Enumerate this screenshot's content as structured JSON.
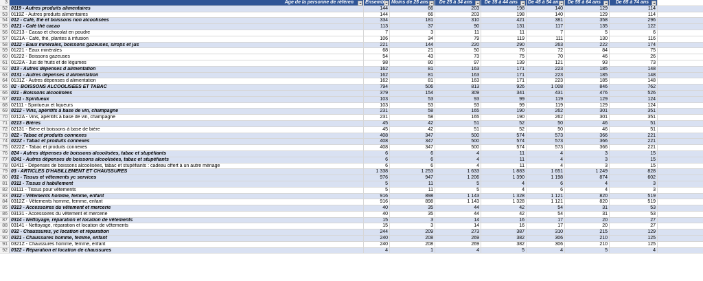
{
  "header": {
    "row_num": "3",
    "title": "Âge de la personne de référen",
    "columns": [
      "Ensemble",
      "Moins de 25 ans",
      "De 25 à 34 ans",
      "De 35 à 44 ans",
      "De 45 à 54 ans",
      "De 55 à 64 ans",
      "De 65 à 74 ans"
    ]
  },
  "rows": [
    {
      "n": "52",
      "label": "0119 - Autres produits alimentaires",
      "bold": true,
      "vals": [
        "144",
        "66",
        "203",
        "198",
        "140",
        "129",
        "114"
      ]
    },
    {
      "n": "53",
      "label": "0119Z - Autres produits alimentaires",
      "bold": false,
      "vals": [
        "144",
        "66",
        "203",
        "198",
        "140",
        "129",
        "114"
      ]
    },
    {
      "n": "54",
      "label": "012 - Café, thé et boissons non alcoolisées",
      "bold": true,
      "vals": [
        "334",
        "181",
        "310",
        "421",
        "381",
        "358",
        "296"
      ]
    },
    {
      "n": "55",
      "label": "0121 - Café thé cacao",
      "bold": true,
      "vals": [
        "113",
        "37",
        "90",
        "131",
        "117",
        "135",
        "122"
      ]
    },
    {
      "n": "56",
      "label": "01213 - Cacao et chocolat en poudre",
      "bold": false,
      "vals": [
        "7",
        "3",
        "11",
        "11",
        "7",
        "5",
        "6"
      ]
    },
    {
      "n": "57",
      "label": "0121A - Café, thé, plantes à infusion",
      "bold": false,
      "vals": [
        "106",
        "34",
        "79",
        "119",
        "111",
        "130",
        "116"
      ]
    },
    {
      "n": "58",
      "label": "0122 - Eaux minérales, boissons gazeuses, sirops et jus",
      "bold": true,
      "vals": [
        "221",
        "144",
        "220",
        "290",
        "263",
        "222",
        "174"
      ]
    },
    {
      "n": "59",
      "label": "01221 - Eaux minérales",
      "bold": false,
      "vals": [
        "68",
        "21",
        "50",
        "76",
        "72",
        "84",
        "75"
      ]
    },
    {
      "n": "60",
      "label": "01222 - Boissons gazeuses",
      "bold": false,
      "vals": [
        "54",
        "43",
        "73",
        "75",
        "70",
        "46",
        "26"
      ]
    },
    {
      "n": "61",
      "label": "0122A - Jus de fruits et de légumes",
      "bold": false,
      "vals": [
        "98",
        "80",
        "97",
        "139",
        "121",
        "93",
        "73"
      ]
    },
    {
      "n": "62",
      "label": "013 - Autres dépenses d alimentation",
      "bold": true,
      "vals": [
        "162",
        "81",
        "163",
        "171",
        "223",
        "185",
        "148"
      ]
    },
    {
      "n": "63",
      "label": "0131 - Autres dépenses d alimentation",
      "bold": true,
      "vals": [
        "162",
        "81",
        "163",
        "171",
        "223",
        "185",
        "148"
      ]
    },
    {
      "n": "64",
      "label": "0131Z - Autres dépenses d alimentation",
      "bold": false,
      "vals": [
        "162",
        "81",
        "163",
        "171",
        "223",
        "185",
        "148"
      ]
    },
    {
      "n": "65",
      "label": "02 - BOISSONS ALCOOLISEES ET TABAC",
      "bold": true,
      "vals": [
        "794",
        "506",
        "813",
        "926",
        "1 008",
        "846",
        "762"
      ]
    },
    {
      "n": "66",
      "label": "021 - Boissons alcoolisées",
      "bold": true,
      "vals": [
        "379",
        "154",
        "309",
        "341",
        "431",
        "476",
        "526"
      ]
    },
    {
      "n": "67",
      "label": "0211 - Spiritueux",
      "bold": true,
      "vals": [
        "103",
        "53",
        "93",
        "99",
        "119",
        "129",
        "124"
      ]
    },
    {
      "n": "68",
      "label": "02111 - Spiritueux et liqueurs",
      "bold": false,
      "vals": [
        "103",
        "53",
        "93",
        "99",
        "119",
        "129",
        "124"
      ]
    },
    {
      "n": "69",
      "label": "0212 - Vins, apéritifs à base de vin, champagne",
      "bold": true,
      "vals": [
        "231",
        "58",
        "165",
        "190",
        "262",
        "301",
        "351"
      ]
    },
    {
      "n": "70",
      "label": "0212A - Vins, apéritifs à base de vin, champagne",
      "bold": false,
      "vals": [
        "231",
        "58",
        "165",
        "190",
        "262",
        "301",
        "351"
      ]
    },
    {
      "n": "71",
      "label": "0213 - Bières",
      "bold": true,
      "vals": [
        "45",
        "42",
        "51",
        "52",
        "50",
        "46",
        "51"
      ]
    },
    {
      "n": "72",
      "label": "02131 - Bière et boissons à base de bière",
      "bold": false,
      "vals": [
        "45",
        "42",
        "51",
        "52",
        "50",
        "46",
        "51"
      ]
    },
    {
      "n": "73",
      "label": "022 - Tabac et produits connexes",
      "bold": true,
      "vals": [
        "408",
        "347",
        "500",
        "574",
        "573",
        "366",
        "221"
      ]
    },
    {
      "n": "74",
      "label": "022Z - Tabac et produits connexes",
      "bold": true,
      "vals": [
        "408",
        "347",
        "500",
        "574",
        "573",
        "366",
        "221"
      ]
    },
    {
      "n": "75",
      "label": "0222Z - Tabac et produits connexes",
      "bold": false,
      "vals": [
        "408",
        "347",
        "500",
        "574",
        "573",
        "366",
        "221"
      ]
    },
    {
      "n": "76",
      "label": "024 - Autres dépenses de boissons alcoolisées, tabac et stupéfiants",
      "bold": true,
      "vals": [
        "6",
        "6",
        "4",
        "11",
        "4",
        "3",
        "15"
      ]
    },
    {
      "n": "77",
      "label": "0241 - Autres dépenses de boissons alcoolisées, tabac et stupéfiants",
      "bold": true,
      "vals": [
        "6",
        "6",
        "4",
        "11",
        "4",
        "3",
        "15"
      ]
    },
    {
      "n": "78",
      "label": "02411 - Dépenses de boissons alcoolisées, tabac et stupéfiants : cadeau offert à un autre ménage",
      "bold": false,
      "vals": [
        "6",
        "6",
        "4",
        "11",
        "4",
        "3",
        "15"
      ]
    },
    {
      "n": "79",
      "label": "03 - ARTICLES D'HABILLEMENT ET CHAUSSURES",
      "bold": true,
      "vals": [
        "1 338",
        "1 253",
        "1 633",
        "1 883",
        "1 651",
        "1 249",
        "828"
      ]
    },
    {
      "n": "80",
      "label": "031 - Tissus et vêtements yc services",
      "bold": true,
      "vals": [
        "976",
        "947",
        "1 206",
        "1 390",
        "1 198",
        "874",
        "602"
      ]
    },
    {
      "n": "81",
      "label": "0311 - Tissus d habillement",
      "bold": true,
      "vals": [
        "5",
        "11",
        "5",
        "4",
        "6",
        "4",
        "3"
      ]
    },
    {
      "n": "82",
      "label": "03111 - Tissus pour vêtements",
      "bold": false,
      "vals": [
        "5",
        "11",
        "5",
        "4",
        "6",
        "4",
        "3"
      ]
    },
    {
      "n": "83",
      "label": "0312 - Vêtements homme, femme, enfant",
      "bold": true,
      "vals": [
        "916",
        "898",
        "1 143",
        "1 328",
        "1 121",
        "820",
        "519"
      ]
    },
    {
      "n": "84",
      "label": "0312Z - Vêtements homme, femme, enfant",
      "bold": false,
      "vals": [
        "916",
        "898",
        "1 143",
        "1 328",
        "1 121",
        "820",
        "519"
      ]
    },
    {
      "n": "85",
      "label": "0313 - Accessoires du vêtement et mercerie",
      "bold": true,
      "vals": [
        "40",
        "35",
        "44",
        "42",
        "54",
        "31",
        "53"
      ]
    },
    {
      "n": "86",
      "label": "03131 - Accessoires du vêtement et mercerie",
      "bold": false,
      "vals": [
        "40",
        "35",
        "44",
        "42",
        "54",
        "31",
        "53"
      ]
    },
    {
      "n": "87",
      "label": "0314 - Nettoyage, réparation et location de vêtements",
      "bold": true,
      "vals": [
        "15",
        "3",
        "14",
        "16",
        "17",
        "20",
        "27"
      ]
    },
    {
      "n": "88",
      "label": "03141 - Nettoyage, réparation et location de vêtements",
      "bold": false,
      "vals": [
        "15",
        "3",
        "14",
        "16",
        "17",
        "20",
        "27"
      ]
    },
    {
      "n": "89",
      "label": "032 - Chaussures, yc location et réparation",
      "bold": true,
      "vals": [
        "244",
        "209",
        "273",
        "387",
        "310",
        "215",
        "129"
      ]
    },
    {
      "n": "90",
      "label": "0321 - Chaussures homme, femme, enfant",
      "bold": true,
      "vals": [
        "240",
        "208",
        "269",
        "382",
        "306",
        "210",
        "125"
      ]
    },
    {
      "n": "91",
      "label": "0321Z - Chaussures homme, femme, enfant",
      "bold": false,
      "vals": [
        "240",
        "208",
        "269",
        "382",
        "306",
        "210",
        "125"
      ]
    },
    {
      "n": "92",
      "label": "0322 - Réparation et location de chaussures",
      "bold": true,
      "vals": [
        "4",
        "1",
        "4",
        "5",
        "4",
        "5",
        "4"
      ]
    }
  ]
}
